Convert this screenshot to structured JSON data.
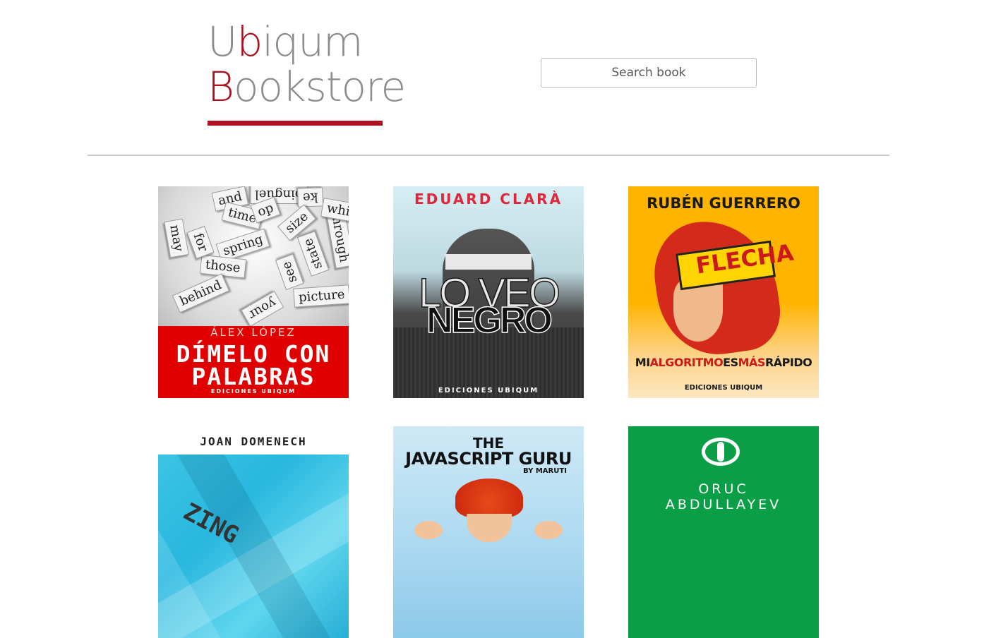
{
  "header": {
    "logo_line1_pre": "U",
    "logo_line1_accent": "b",
    "logo_line1_post": "iqum",
    "logo_line2_accent": "B",
    "logo_line2_post": "ookstore",
    "search_placeholder": "Search book"
  },
  "colors": {
    "brand": "#b01020",
    "logo_grey": "#8c8c8c",
    "divider": "#c8c8c8"
  },
  "books": [
    {
      "author": "ÁLEX LÓPEZ",
      "title_line1": "DÍMELO CON",
      "title_line2": "PALABRAS",
      "publisher": "EDICIONES UBIQUM",
      "words": [
        "and",
        "pinguel",
        "ke",
        "time",
        "op",
        "size",
        "spring",
        "those",
        "behind",
        "picture",
        "your",
        "see",
        "state",
        "through",
        "may",
        "for",
        "whi"
      ]
    },
    {
      "author": "EDUARD CLARÀ",
      "title_line1": "LO VEO",
      "title_line2": "NEGRO",
      "publisher": "EDICIONES UBIQUM"
    },
    {
      "author": "RUBÉN GUERRERO",
      "badge": "FLECHA",
      "tagline_parts": [
        "MI",
        "ALGORITMO",
        "ES",
        "MÁS",
        "RÁPIDO"
      ],
      "publisher": "EDICIONES UBIQUM"
    },
    {
      "author": "JOAN DOMENECH",
      "partial_title": "ZING"
    },
    {
      "title_line1": "THE",
      "title_line2": "JAVASCRIPT GURU",
      "byline": "BY MARUTI"
    },
    {
      "author_line1": "ORUC",
      "author_line2": "ABDULLAYEV"
    }
  ]
}
